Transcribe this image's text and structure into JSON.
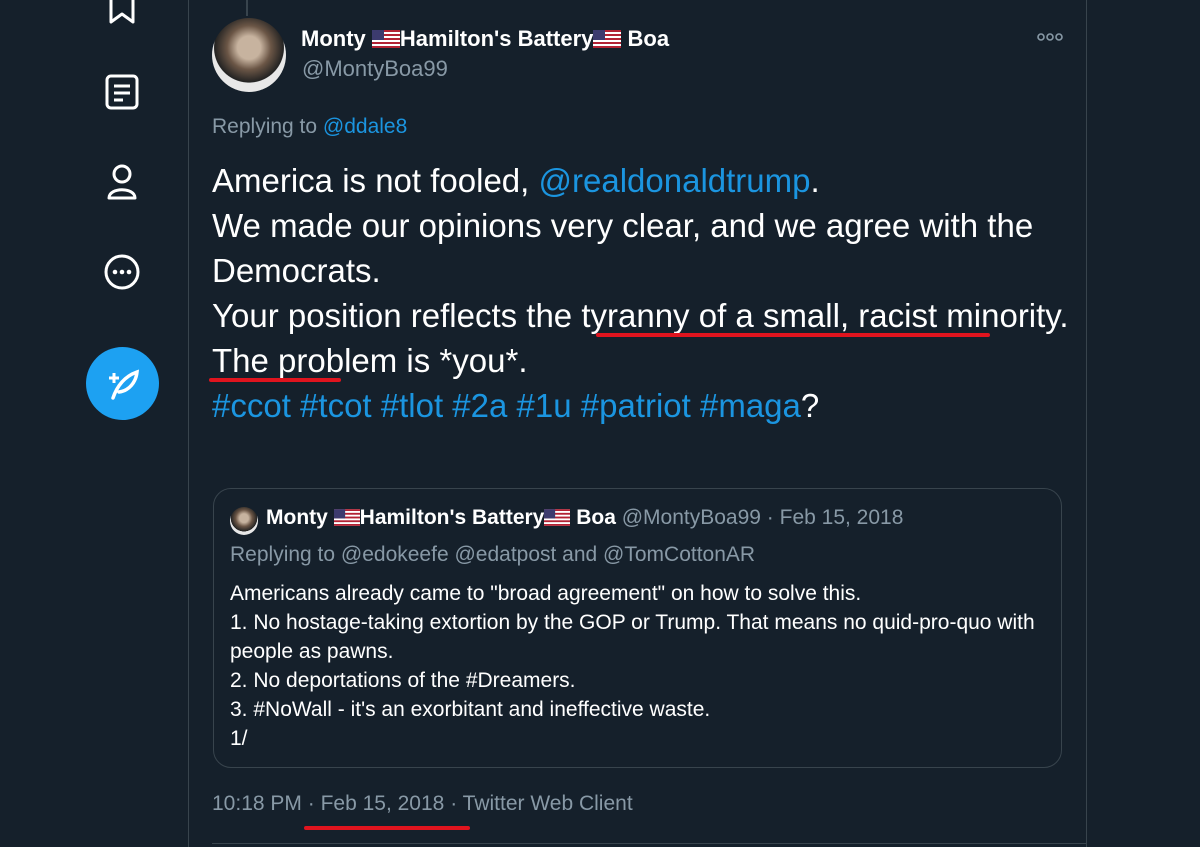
{
  "tweet": {
    "display_name_pre": "Monty ",
    "display_name_mid": "Hamilton's Battery",
    "display_name_post": " Boa",
    "handle": "@MontyBoa99",
    "replying_to_prefix": "Replying to ",
    "replying_to_handle": "@ddale8",
    "lines": {
      "l1_a": "America is not fooled, ",
      "l1_mention": "@realdonaldtrump",
      "l1_b": ".",
      "l2": "We made our opinions very clear, and we agree with the Democrats.",
      "l3_a": "Your position reflects the ",
      "l3_b": "tyranny of a small, racist minority.",
      "l4": "The problem is *you*.",
      "hashtags": "#ccot #tcot #tlot #2a #1u #patriot #maga",
      "trailing": "?"
    },
    "time": "10:18 PM",
    "sep": "·",
    "date": "Feb 15, 2018",
    "client": "Twitter Web Client"
  },
  "quoted": {
    "display_name_pre": "Monty ",
    "display_name_mid": "Hamilton's Battery",
    "display_name_post": " Boa",
    "meta": "@MontyBoa99 · Feb 15, 2018",
    "replying": "Replying to @edokeefe @edatpost and @TomCottonAR",
    "lines": [
      "Americans already came to \"broad agreement\" on how to solve this.",
      "1. No hostage-taking extortion by the GOP or Trump. That means no quid-pro-quo with people as pawns.",
      "2. No deportations of the #Dreamers.",
      "3. #NoWall - it's an exorbitant and ineffective waste.",
      "1/"
    ]
  },
  "colors": {
    "background": "#15202b",
    "link": "#1b95e0",
    "muted": "#8899a6",
    "annotation": "#e0141e"
  },
  "icons": [
    "bookmark-icon",
    "lists-icon",
    "profile-icon",
    "more-icon",
    "compose-tweet-icon",
    "more-options-icon",
    "us-flag-icon"
  ]
}
